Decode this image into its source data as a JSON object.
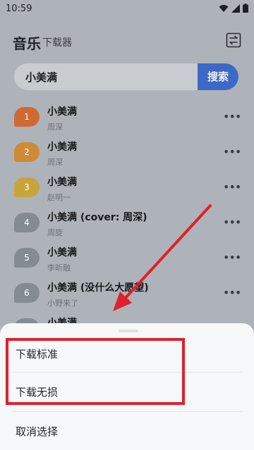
{
  "status_bar": {
    "time": "10:59"
  },
  "header": {
    "title": "音乐",
    "subtitle": "下载器"
  },
  "search": {
    "value": "小美满",
    "button_label": "搜索"
  },
  "more_glyph": "•••",
  "songs": [
    {
      "rank": "1",
      "title": "小美满",
      "artist": "周深",
      "badge_color": "#cf6a34"
    },
    {
      "rank": "2",
      "title": "小美满",
      "artist": "周深",
      "badge_color": "#cf8a36"
    },
    {
      "rank": "3",
      "title": "小美满",
      "artist": "赵明一",
      "badge_color": "#c8a43a"
    },
    {
      "rank": "4",
      "title": "小美满 (cover: 周深)",
      "artist": "周旋",
      "badge_color": "#848b93"
    },
    {
      "rank": "5",
      "title": "小美满",
      "artist": "李昕融",
      "badge_color": "#848b93"
    },
    {
      "rank": "6",
      "title": "小美满 (没什么大愿望)",
      "artist": "小野来了",
      "badge_color": "#848b93"
    },
    {
      "rank": "",
      "title": "小美满",
      "artist": "",
      "badge_color": "#848b93"
    }
  ],
  "sheet": {
    "options": [
      {
        "label": "下载标准"
      },
      {
        "label": "下载无损"
      },
      {
        "label": "取消选择"
      }
    ]
  },
  "colors": {
    "accent": "#3e68c8",
    "annotation": "#e0202c"
  }
}
